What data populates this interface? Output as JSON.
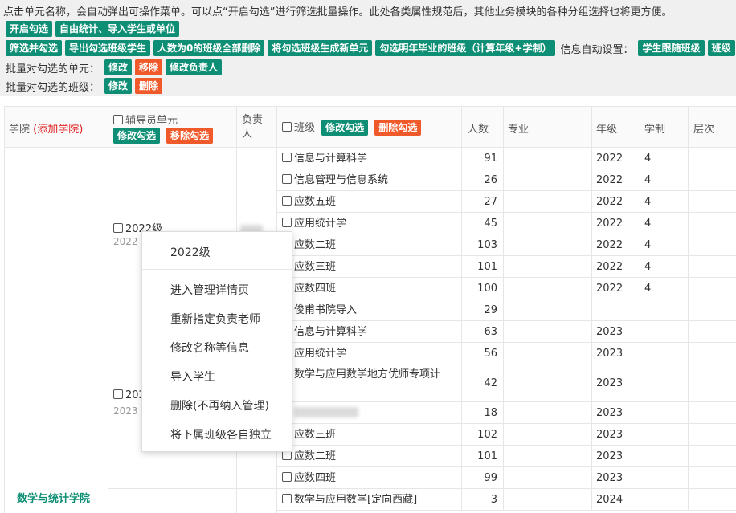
{
  "toolbar": {
    "notice": "点击单元名称，会自动弹出可操作菜单。可以点“开启勾选”进行筛选批量操作。此处各类属性规范后，其他业务模块的各种分组选择也将更方便。",
    "row1": [
      "开启勾选",
      "自由统计、导入学生或单位"
    ],
    "row2": [
      "筛选并勾选",
      "导出勾选班级学生",
      "人数为0的班级全部删除",
      "将勾选班级生成新单元",
      "勾选明年毕业的班级（计算年级+学制）"
    ],
    "auto_setting_label": "信息自动设置：",
    "row2_right": [
      "学生跟随班级",
      "班级"
    ],
    "unit_batch_label": "批量对勾选的单元：",
    "unit_batch": {
      "edit": "修改",
      "remove": "移除",
      "edit_owner": "修改负责人"
    },
    "class_batch_label": "批量对勾选的班级：",
    "class_batch": {
      "edit": "修改",
      "delete": "删除"
    }
  },
  "table": {
    "headers": {
      "college": "学院",
      "add_college": "(添加学院)",
      "unit": "辅导员单元",
      "unit_edit": "修改勾选",
      "unit_remove": "移除勾选",
      "owner_line1": "负责",
      "owner_line2": "人",
      "class": "班级",
      "class_edit": "修改勾选",
      "class_delete": "删除勾选",
      "count": "人数",
      "major": "专业",
      "grade": "年级",
      "years": "学制",
      "level": "层次"
    },
    "college_name": "数学与统计学院",
    "units": [
      {
        "name": "2022级",
        "sub": "2022"
      },
      {
        "name": "202",
        "sub": "2023"
      }
    ],
    "rows": [
      {
        "name": "信息与计算科学",
        "count": "91",
        "grade": "2022",
        "years": "4"
      },
      {
        "name": "信息管理与信息系统",
        "count": "26",
        "grade": "2022",
        "years": "4"
      },
      {
        "name": "应数五班",
        "count": "27",
        "grade": "2022",
        "years": "4"
      },
      {
        "name": "应用统计学",
        "count": "45",
        "grade": "2022",
        "years": "4"
      },
      {
        "name": "应数二班",
        "count": "103",
        "grade": "2022",
        "years": "4"
      },
      {
        "name": "应数三班",
        "count": "101",
        "grade": "2022",
        "years": "4"
      },
      {
        "name": "应数四班",
        "count": "100",
        "grade": "2022",
        "years": "4"
      },
      {
        "name": "俊甫书院导入",
        "count": "29",
        "grade": "",
        "years": ""
      },
      {
        "name": "信息与计算科学",
        "count": "63",
        "grade": "2023",
        "years": ""
      },
      {
        "name": "应用统计学",
        "count": "56",
        "grade": "2023",
        "years": ""
      },
      {
        "name": "数学与应用数学地方优师专项计",
        "count": "42",
        "grade": "2023",
        "years": ""
      },
      {
        "name": "",
        "count": "18",
        "grade": "2023",
        "years": ""
      },
      {
        "name": "应数三班",
        "count": "102",
        "grade": "2023",
        "years": ""
      },
      {
        "name": "应数二班",
        "count": "101",
        "grade": "2023",
        "years": ""
      },
      {
        "name": "应数四班",
        "count": "99",
        "grade": "2023",
        "years": ""
      },
      {
        "name": "数学与应用数学[定向西藏]",
        "count": "3",
        "grade": "2024",
        "years": ""
      }
    ]
  },
  "context_menu": {
    "title": "2022级",
    "items": [
      "进入管理详情页",
      "重新指定负责老师",
      "修改名称等信息",
      "导入学生",
      "删除(不再纳入管理)",
      "将下属班级各自独立"
    ]
  }
}
